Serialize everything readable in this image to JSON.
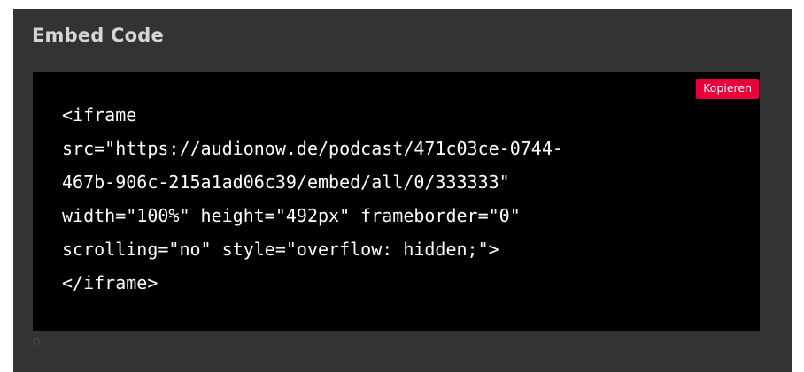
{
  "embed": {
    "title": "Embed Code",
    "copy_label": "Kopieren",
    "code": "<iframe\nsrc=\"https://audionow.de/podcast/471c03ce-0744-\n467b-906c-215a1ad06c39/embed/all/0/333333\"\nwidth=\"100%\" height=\"492px\" frameborder=\"0\"\nscrolling=\"no\" style=\"overflow: hidden;\">\n</iframe>",
    "footer_mark": "D"
  },
  "colors": {
    "panel_background": "#333333",
    "code_background": "#000000",
    "accent": "#e8003d",
    "title_text": "#d6d6d6"
  }
}
